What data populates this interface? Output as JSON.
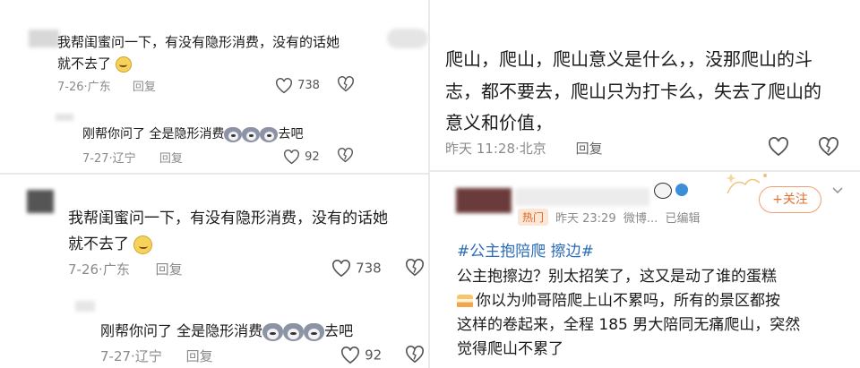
{
  "panel1": {
    "comment1": {
      "line1": "我帮闺蜜问一下，有没有隐形消费，没有的话她",
      "line2": "就不去了",
      "meta_date": "7-26",
      "meta_loc": "广东",
      "reply_label": "回复",
      "likes": "738"
    },
    "reply1": {
      "text_pre": "刚帮你问了 全是隐形消费",
      "text_post": "去吧",
      "meta_date": "7-27",
      "meta_loc": "辽宁",
      "reply_label": "回复",
      "likes": "92"
    }
  },
  "panel2": {
    "comment1": {
      "line1": "我帮闺蜜问一下，有没有隐形消费，没有的话她",
      "line2": "就不去了",
      "meta_date": "7-26",
      "meta_loc": "广东",
      "reply_label": "回复",
      "likes": "738"
    },
    "reply1": {
      "text_pre": "刚帮你问了 全是隐形消费",
      "text_post": "去吧",
      "meta_date": "7-27",
      "meta_loc": "辽宁",
      "reply_label": "回复",
      "likes": "92"
    }
  },
  "panel3": {
    "line1": "爬山，爬山，爬山意义是什么，，没那爬山的斗",
    "line2": "志，都不要去，爬山只为打卡么，失去了爬山的",
    "line3": "意义和价值，",
    "meta_time": "昨天 11:28",
    "meta_loc": "北京",
    "reply_label": "回复"
  },
  "panel4": {
    "badge": "热门",
    "meta": "昨天 23:29  微博...  已编辑",
    "follow_label": "+关注",
    "hashtags": "#公主抱陪爬 擦边#",
    "line1": "公主抱擦边？别太招笑了，这又是动了谁的蛋糕",
    "line2": "你以为帅哥陪爬上山不累吗，所有的景区都按",
    "line3": "这样的卷起来，全程 185 男大陪同无痛爬山，突然",
    "line4": "觉得爬山不累了"
  },
  "colors": {
    "text": "#1a1a1a",
    "meta": "#8a8a8a",
    "hashtag": "#2b6cb8",
    "badge_bg": "#fbe7d8",
    "badge_text": "#e0661a",
    "follow_border": "#f0a070",
    "follow_text": "#e07030"
  }
}
